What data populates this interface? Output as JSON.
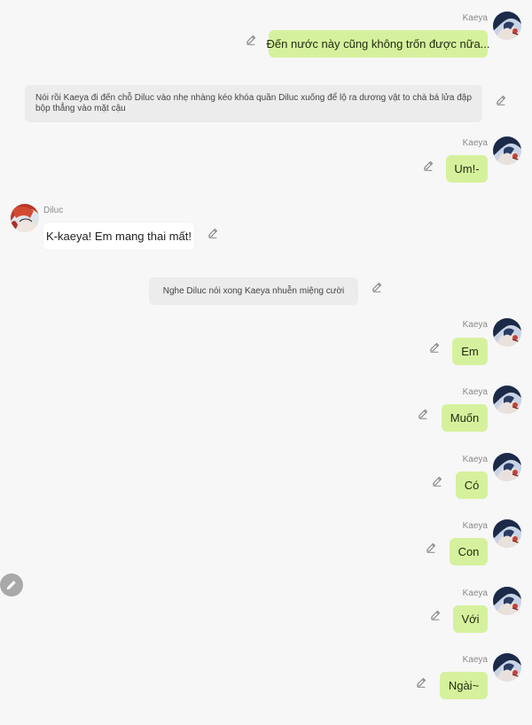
{
  "messages": [
    {
      "speaker": "Kaeya",
      "text": "Đến nước này cũng không trốn được nữa..."
    },
    {
      "narration": "Nói rồi Kaeya đi đến chỗ Diluc vào nhẹ nhàng kéo khóa quần Diluc xuống để lộ ra dương vật to chà bá lửa đập bộp thẳng vào mặt cậu"
    },
    {
      "speaker": "Kaeya",
      "text": "Um!-"
    },
    {
      "speaker": "Diluc",
      "text": "K-kaeya! Em mang thai mất!"
    },
    {
      "narration": "Nghe Diluc nói xong Kaeya nhuễn miệng cười"
    },
    {
      "speaker": "Kaeya",
      "text": "Em"
    },
    {
      "speaker": "Kaeya",
      "text": "Muốn"
    },
    {
      "speaker": "Kaeya",
      "text": "Có"
    },
    {
      "speaker": "Kaeya",
      "text": "Con"
    },
    {
      "speaker": "Kaeya",
      "text": "Với"
    },
    {
      "speaker": "Kaeya",
      "text": "Ngài~"
    }
  ],
  "icons": {
    "edit": "pencil-icon",
    "fab": "pencil-icon"
  },
  "colors": {
    "background": "#f7f7f7",
    "bubble_self": "#d6f19d",
    "bubble_other": "#ffffff",
    "bubble_narration": "#ececec",
    "fab": "#a9a9a9"
  }
}
